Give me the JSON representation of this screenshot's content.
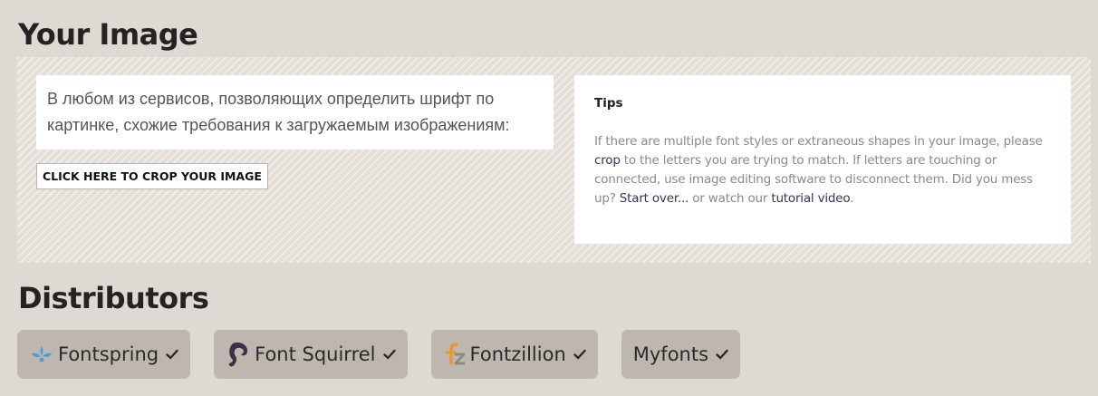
{
  "your_image": {
    "title": "Your Image",
    "image_text_lines": [
      "В любом из сервисов, позволяющих определить шрифт по",
      "картинке, схожие требования к загружаемым изображениям:"
    ],
    "crop_button_label": "CLICK HERE TO CROP YOUR IMAGE",
    "tips": {
      "title": "Tips",
      "text_1": "If there are multiple font styles or extraneous shapes in your image, please ",
      "link_crop": "crop",
      "text_2": " to the letters you are trying to match. If letters are touching or connected, use image editing software to disconnect them. Did you mess up? ",
      "link_start_over": "Start over...",
      "text_3": " or watch our ",
      "link_tutorial": "tutorial video",
      "text_4": "."
    }
  },
  "distributors": {
    "title": "Distributors",
    "items": [
      {
        "label": "Fontspring",
        "icon": "fontspring-logo-icon",
        "check": "check-icon"
      },
      {
        "label": "Font Squirrel",
        "icon": "font-squirrel-logo-icon",
        "check": "check-icon"
      },
      {
        "label": "Fontzillion",
        "icon": "fontzillion-logo-icon",
        "check": "check-icon"
      },
      {
        "label": "Myfonts",
        "icon": "",
        "check": "check-icon"
      }
    ]
  },
  "colors": {
    "page_background": "#ded9d2",
    "distributor_button": "#bdb7af",
    "link": "#3b3357",
    "tips_text": "#8a8a8a",
    "fontspring_blue": "#4a9fd6",
    "squirrel_purple": "#3d2f45",
    "fontzillion_orange": "#e8962e"
  }
}
